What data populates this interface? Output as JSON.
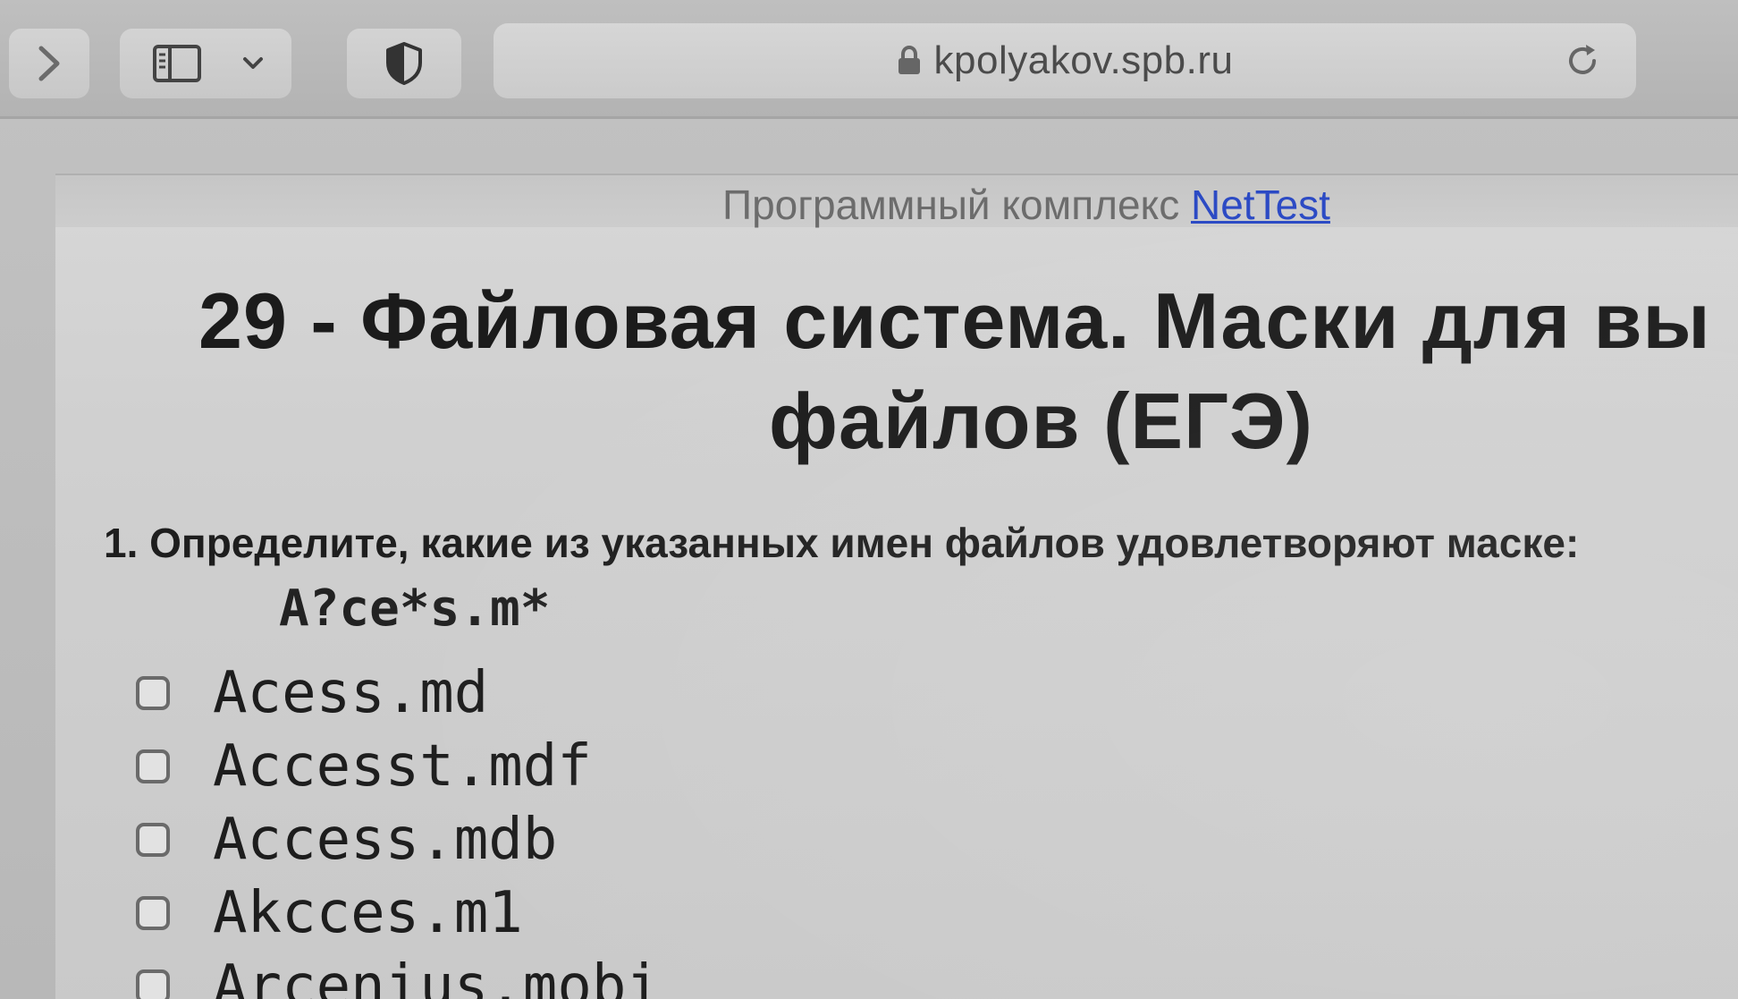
{
  "browser": {
    "url": "kpolyakov.spb.ru",
    "icons": {
      "forward": "chevron-right-icon",
      "sidebar": "sidebar-icon",
      "sidebar_menu": "chevron-down-icon",
      "privacy": "shield-half-icon",
      "lock": "lock-icon",
      "reload": "reload-icon"
    }
  },
  "page": {
    "header_prefix": "Программный комплекс",
    "header_link": "NetTest",
    "title_line1": "29 - Файловая система. Маски для вы",
    "title_line2": "файлов (ЕГЭ)",
    "question": "1. Определите, какие из указанных имен файлов удовлетворяют маске:",
    "mask": "A?ce*s.m*",
    "options": [
      {
        "label": "Acess.md",
        "checked": false
      },
      {
        "label": "Accesst.mdf",
        "checked": false
      },
      {
        "label": "Access.mdb",
        "checked": false
      },
      {
        "label": "Akcces.m1",
        "checked": false
      },
      {
        "label": "Arcenius.mobi",
        "checked": false
      }
    ]
  },
  "colors": {
    "link": "#2a49c4",
    "text": "#1b1b1b"
  }
}
